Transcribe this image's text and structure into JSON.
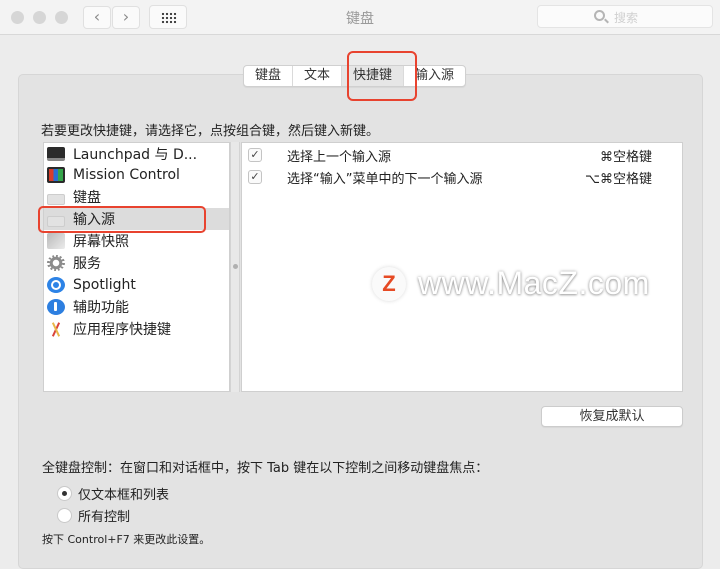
{
  "window": {
    "title": "键盘",
    "nav_back": "‹",
    "nav_forward": "›",
    "search_placeholder": "搜索"
  },
  "tabs": [
    {
      "label": "键盘",
      "active": false
    },
    {
      "label": "文本",
      "active": false
    },
    {
      "label": "快捷键",
      "active": true
    },
    {
      "label": "输入源",
      "active": false
    }
  ],
  "instruction": "若要更改快捷键，请选择它，点按组合键，然后键入新键。",
  "categories": [
    {
      "label": "Launchpad 与 D...",
      "icon": "launchpad-icon"
    },
    {
      "label": "Mission Control",
      "icon": "mission-control-icon"
    },
    {
      "label": "键盘",
      "icon": "keyboard-icon"
    },
    {
      "label": "输入源",
      "icon": "input-source-icon",
      "selected": true
    },
    {
      "label": "屏幕快照",
      "icon": "screenshot-icon"
    },
    {
      "label": "服务",
      "icon": "gear-icon"
    },
    {
      "label": "Spotlight",
      "icon": "spotlight-icon"
    },
    {
      "label": "辅助功能",
      "icon": "accessibility-icon"
    },
    {
      "label": "应用程序快捷键",
      "icon": "app-shortcuts-icon"
    }
  ],
  "shortcuts": [
    {
      "checked": true,
      "check_glyph": "✓",
      "description": "选择上一个输入源",
      "key": "⌘空格键"
    },
    {
      "checked": true,
      "check_glyph": "✓",
      "description": "选择“输入”菜单中的下一个输入源",
      "key": "⌥⌘空格键"
    }
  ],
  "watermark": {
    "logo": "Z",
    "text": "www.MacZ.com"
  },
  "restore_button": "恢复成默认",
  "full_keyboard": {
    "label": "全键盘控制：在窗口和对话框中，按下 Tab 键在以下控制之间移动键盘焦点：",
    "options": [
      {
        "label": "仅文本框和列表",
        "selected": true
      },
      {
        "label": "所有控制",
        "selected": false
      }
    ],
    "hint": "按下 Control+F7 来更改此设置。"
  },
  "colors": {
    "highlight": "#e8432f",
    "panel": "#e3e3e3",
    "selection": "#dcdcdc"
  }
}
